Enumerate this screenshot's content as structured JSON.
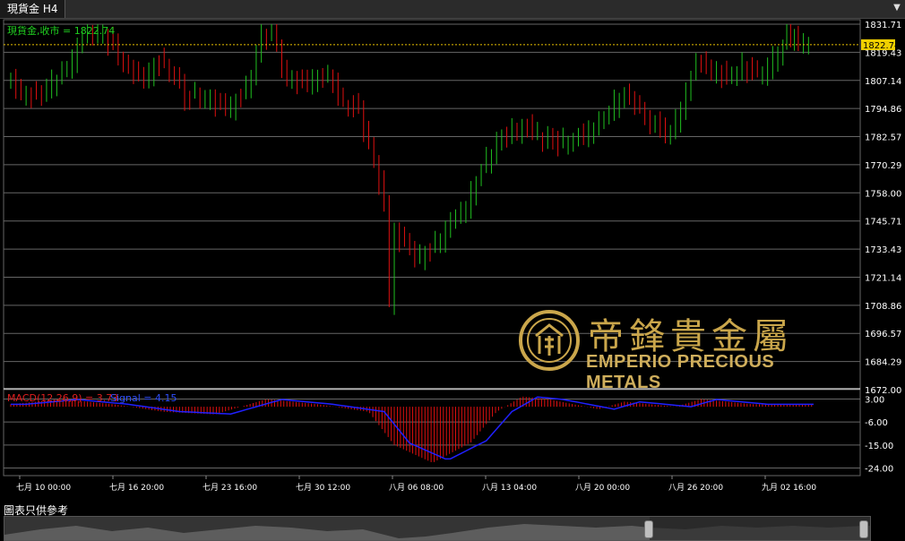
{
  "tab": {
    "label": "現貨金 H4"
  },
  "chart_data": {
    "type": "candlestick",
    "title": "現貨金,收市 = 1822.74",
    "price_axis": {
      "ticks": [
        "1831.71",
        "1819.43",
        "1807.14",
        "1794.86",
        "1782.57",
        "1770.29",
        "1758.00",
        "1745.71",
        "1733.43",
        "1721.14",
        "1708.86",
        "1696.57",
        "1684.29",
        "1672.00"
      ],
      "min": 1672.0,
      "max": 1831.71
    },
    "current_price": "1822.74",
    "macd": {
      "label": "MACD(12,26,9) = 3.73",
      "signal_label": "Signal = 4.15",
      "ticks": [
        "3.00",
        "-6.00",
        "-15.00",
        "-24.00"
      ]
    },
    "time_axis": {
      "labels": [
        "七月 10 00:00",
        "七月 16 20:00",
        "七月 23 16:00",
        "七月 30 12:00",
        "八月 06 08:00",
        "八月 13 04:00",
        "八月 20 00:00",
        "八月 26 20:00",
        "九月 02 16:00"
      ]
    },
    "colors": {
      "bull": "#20c020",
      "bear": "#e01010",
      "macd_hist": "#e01010",
      "signal": "#2020ff",
      "grid": "#666666",
      "current": "#e8c000"
    }
  },
  "logo": {
    "cn": "帝鋒貴金屬",
    "en": "EMPERIO PRECIOUS METALS"
  },
  "footer": {
    "note": "圖表只供參考"
  }
}
